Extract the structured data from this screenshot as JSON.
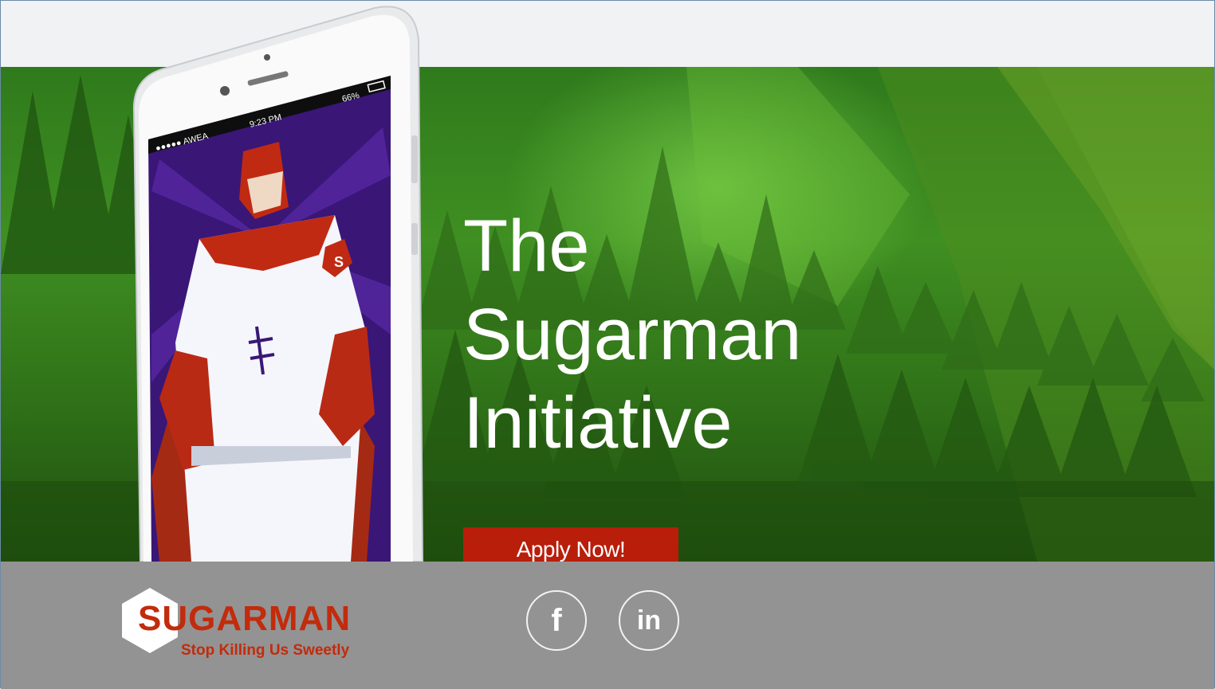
{
  "hero": {
    "headline": [
      "The",
      "Sugarman",
      "Initiative"
    ],
    "cta_label": "Apply Now!",
    "phone": {
      "carrier": "●●●●● AWEA",
      "time": "9:23 PM",
      "battery": "66%"
    },
    "mascot_emblem": "S"
  },
  "footer": {
    "logo": {
      "wordmark": "SUGARMAN",
      "tagline": "Stop Killing Us Sweetly"
    },
    "social": [
      {
        "icon": "facebook-icon",
        "glyph": "f"
      },
      {
        "icon": "linkedin-icon",
        "glyph": "in"
      }
    ]
  },
  "colors": {
    "accent": "#b81e0a",
    "brand_red": "#c22b0c",
    "hero_green": "#3f8f22",
    "footer_gray": "#939393",
    "mascot_purple": "#4a1d8c"
  }
}
